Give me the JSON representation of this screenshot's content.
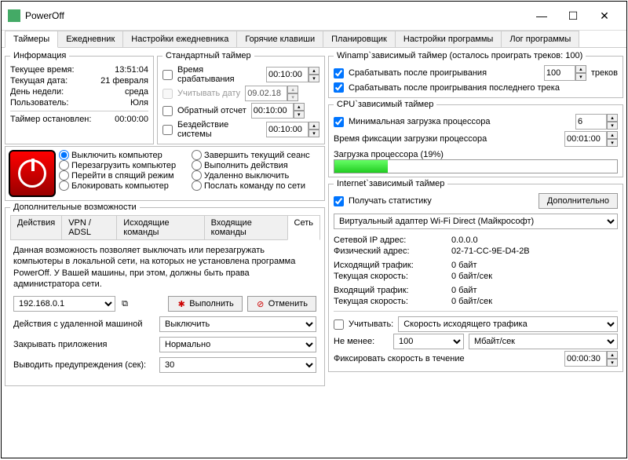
{
  "window": {
    "title": "PowerOff"
  },
  "mainTabs": [
    "Таймеры",
    "Ежедневник",
    "Настройки ежедневника",
    "Горячие клавиши",
    "Планировщик",
    "Настройки программы",
    "Лог программы"
  ],
  "info": {
    "legend": "Информация",
    "time_label": "Текущее время:",
    "time": "13:51:04",
    "date_label": "Текущая дата:",
    "date": "21 февраля",
    "dow_label": "День недели:",
    "dow": "среда",
    "user_label": "Пользователь:",
    "user": "Юля",
    "stopped_label": "Таймер остановлен:",
    "stopped": "00:00:00"
  },
  "stdTimer": {
    "legend": "Стандартный таймер",
    "trigger_label": "Время срабатывания",
    "trigger_val": "00:10:00",
    "usedate_label": "Учитывать дату",
    "usedate_val": "09.02.18",
    "countdown_label": "Обратный отсчет",
    "countdown_val": "00:10:00",
    "idle_label": "Бездействие системы",
    "idle_val": "00:10:00"
  },
  "actions": {
    "a1": "Выключить компьютер",
    "a2": "Перезагрузить компьютер",
    "a3": "Перейти в спящий режим",
    "a4": "Блокировать компьютер",
    "a5": "Завершить текущий сеанс",
    "a6": "Выполнить действия",
    "a7": "Удаленно выключить",
    "a8": "Послать команду по сети"
  },
  "extra": {
    "legend": "Дополнительные возможности",
    "tabs": [
      "Действия",
      "VPN / ADSL",
      "Исходящие команды",
      "Входящие команды",
      "Сеть"
    ],
    "desc": "Данная возможность позволяет выключать или перезагружать компьютеры в локальной сети, на которых не установлена программа PowerOff. У Вашей машины, при этом, должны быть права администратора сети.",
    "ip": "192.168.0.1",
    "exec_btn": "Выполнить",
    "cancel_btn": "Отменить",
    "remote_label": "Действия с удаленной машиной",
    "remote_val": "Выключить",
    "close_label": "Закрывать приложения",
    "close_val": "Нормально",
    "warn_label": "Выводить предупреждения (сек):",
    "warn_val": "30"
  },
  "winamp": {
    "legend": "Winamp`зависимый таймер (осталось проиграть треков: 100)",
    "after_play": "Срабатывать после проигрывания",
    "tracks": "100",
    "tracks_suffix": "треков",
    "after_last": "Срабатывать после проигрывания последнего трека"
  },
  "cpu": {
    "legend": "CPU`зависимый таймер",
    "min_label": "Минимальная загрузка процессора",
    "min_val": "6",
    "fix_label": "Время фиксации загрузки процессора",
    "fix_val": "00:01:00",
    "load_label": "Загрузка процессора (19%)",
    "load_pct": 19
  },
  "internet": {
    "legend": "Internet`зависимый таймер",
    "stats": "Получать статистику",
    "more_btn": "Дополнительно",
    "adapter": "Виртуальный адаптер Wi-Fi Direct (Майкрософт)",
    "ip_label": "Сетевой IP адрес:",
    "ip": "0.0.0.0",
    "mac_label": "Физический адрес:",
    "mac": "02-71-CC-9E-D4-2B",
    "out_traf_label": "Исходящий трафик:",
    "out_traf": "0 байт",
    "out_speed_label": "Текущая скорость:",
    "out_speed": "0 байт/сек",
    "in_traf_label": "Входящий трафик:",
    "in_traf": "0 байт",
    "in_speed_label": "Текущая скорость:",
    "in_speed": "0 байт/сек",
    "consider": "Учитывать:",
    "consider_val": "Скорость исходящего трафика",
    "min_label": "Не менее:",
    "min_val": "100",
    "min_unit": "Мбайт/сек",
    "fix_label": "Фиксировать скорость в течение",
    "fix_val": "00:00:30"
  }
}
